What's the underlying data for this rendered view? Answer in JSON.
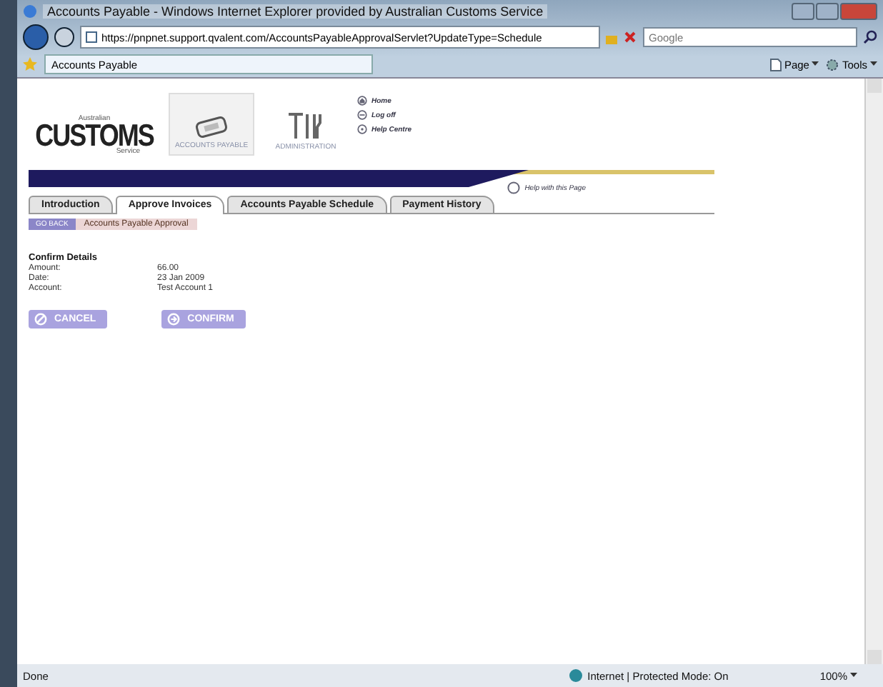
{
  "window": {
    "title": "Accounts Payable - Windows Internet Explorer provided by Australian Customs Service"
  },
  "address_bar": {
    "url": "https://pnpnet.support.qvalent.com/AccountsPayableApprovalServlet?UpdateType=Schedule"
  },
  "search": {
    "placeholder": "Google"
  },
  "browser_tab": {
    "label": "Accounts Payable"
  },
  "command_bar": [
    {
      "label": "Page",
      "kind": "page"
    },
    {
      "label": "Tools",
      "kind": "tools"
    }
  ],
  "logo": {
    "top": "Australian",
    "main": "CUSTOMS",
    "bottom": "Service"
  },
  "modules": [
    {
      "label": "ACCOUNTS PAYABLE",
      "kind": "card",
      "selected": true
    },
    {
      "label": "ADMINISTRATION",
      "kind": "tools",
      "selected": false
    }
  ],
  "links": [
    {
      "label": "Home",
      "kind": "home"
    },
    {
      "label": "Log off",
      "kind": "logoff"
    },
    {
      "label": "Help Centre",
      "kind": "help"
    }
  ],
  "help_link": "Help with this Page",
  "tabs": [
    {
      "label": "Introduction",
      "selected": false
    },
    {
      "label": "Approve Invoices",
      "selected": true
    },
    {
      "label": "Accounts Payable Schedule",
      "selected": false
    },
    {
      "label": "Payment History",
      "selected": false
    }
  ],
  "back_button": "GO BACK",
  "breadcrumb": "Accounts Payable Approval",
  "section_title": "Confirm Details",
  "fields": [
    {
      "label": "Amount:",
      "value": "66.00"
    },
    {
      "label": "Date:",
      "value": "23 Jan 2009"
    },
    {
      "label": "Account:",
      "value": "Test Account 1"
    }
  ],
  "buttons": [
    {
      "label": "CANCEL",
      "kind": "cancel"
    },
    {
      "label": "CONFIRM",
      "kind": "confirm"
    }
  ],
  "status_bar": {
    "text": "Done",
    "zone": "Internet | Protected Mode: On",
    "zoom": "100%"
  }
}
